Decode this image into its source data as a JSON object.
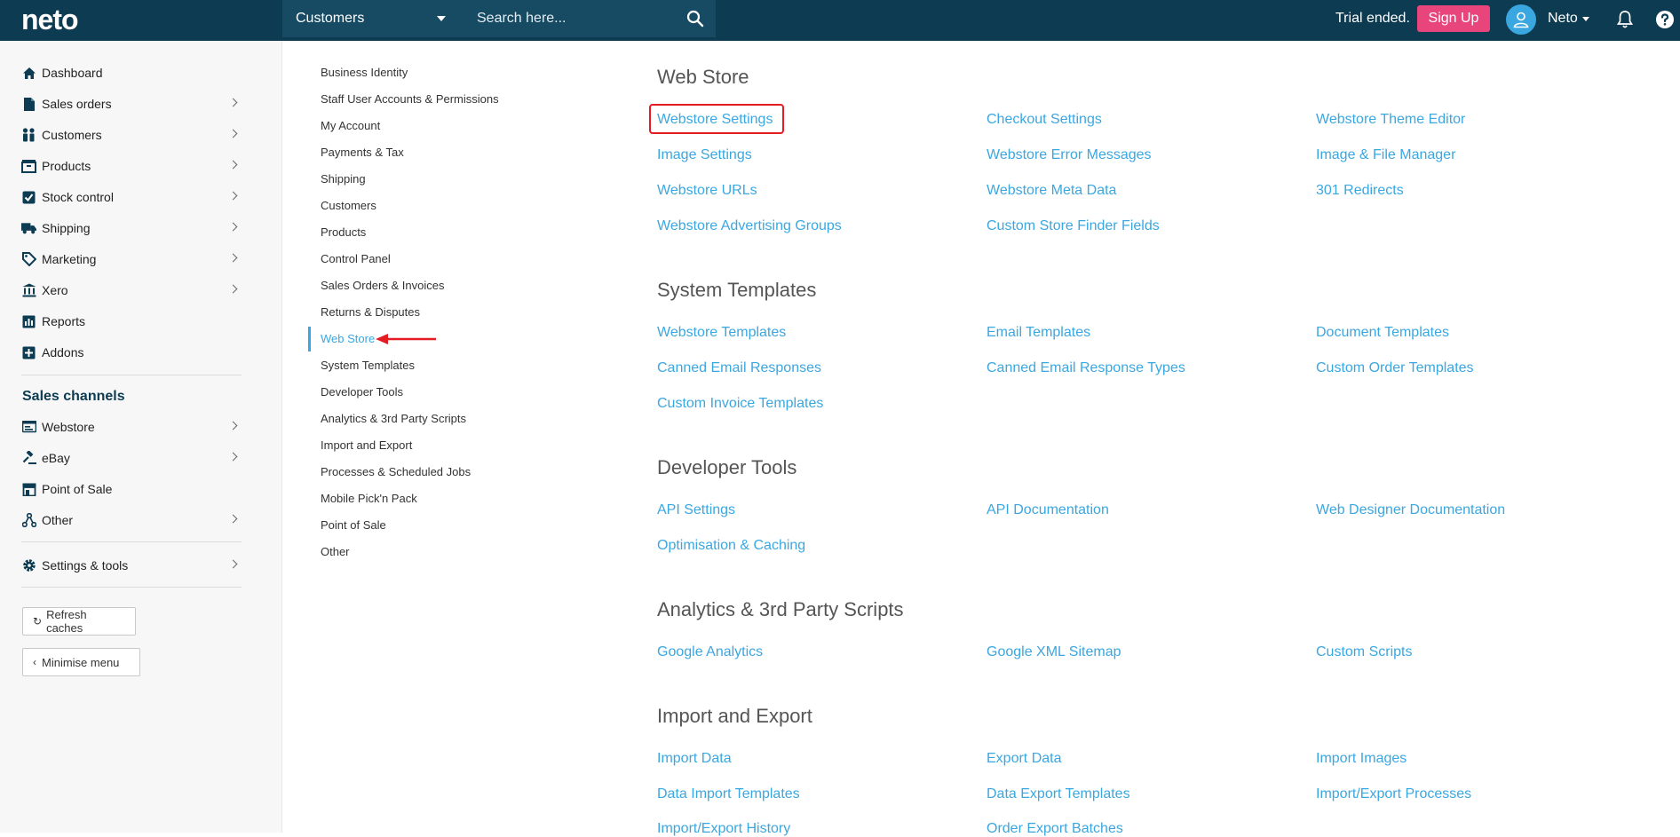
{
  "topbar": {
    "logo": "neto",
    "search_scope": "Customers",
    "search_placeholder": "Search here...",
    "trial_text": "Trial ended.",
    "signup_label": "Sign Up",
    "user_name": "Neto"
  },
  "sidebar": {
    "items": [
      {
        "label": "Dashboard",
        "icon": "home-icon"
      },
      {
        "label": "Sales orders",
        "icon": "document-icon"
      },
      {
        "label": "Customers",
        "icon": "people-icon"
      },
      {
        "label": "Products",
        "icon": "box-icon"
      },
      {
        "label": "Stock control",
        "icon": "checkbox-icon"
      },
      {
        "label": "Shipping",
        "icon": "truck-icon"
      },
      {
        "label": "Marketing",
        "icon": "tag-icon"
      },
      {
        "label": "Xero",
        "icon": "bank-icon"
      },
      {
        "label": "Reports",
        "icon": "chart-icon"
      },
      {
        "label": "Addons",
        "icon": "plus-square-icon"
      }
    ],
    "channels_title": "Sales channels",
    "channels": [
      {
        "label": "Webstore",
        "icon": "monitor-icon"
      },
      {
        "label": "eBay",
        "icon": "gavel-icon"
      },
      {
        "label": "Point of Sale",
        "icon": "store-icon"
      },
      {
        "label": "Other",
        "icon": "share-icon"
      }
    ],
    "settings_label": "Settings & tools",
    "refresh_label": "Refresh caches",
    "minimise_label": "Minimise menu"
  },
  "settings_menu": [
    "Business Identity",
    "Staff User Accounts & Permissions",
    "My Account",
    "Payments & Tax",
    "Shipping",
    "Customers",
    "Products",
    "Control Panel",
    "Sales Orders & Invoices",
    "Returns & Disputes",
    "Web Store",
    "System Templates",
    "Developer Tools",
    "Analytics & 3rd Party Scripts",
    "Import and Export",
    "Processes & Scheduled Jobs",
    "Mobile Pick'n Pack",
    "Point of Sale",
    "Other"
  ],
  "active_menu": "Web Store",
  "sections": [
    {
      "title": "Web Store",
      "links": [
        "Webstore Settings",
        "Checkout Settings",
        "Webstore Theme Editor",
        "Image Settings",
        "Webstore Error Messages",
        "Image & File Manager",
        "Webstore URLs",
        "Webstore Meta Data",
        "301 Redirects",
        "Webstore Advertising Groups",
        "Custom Store Finder Fields"
      ]
    },
    {
      "title": "System Templates",
      "links": [
        "Webstore Templates",
        "Email Templates",
        "Document Templates",
        "Canned Email Responses",
        "Canned Email Response Types",
        "Custom Order Templates",
        "Custom Invoice Templates"
      ]
    },
    {
      "title": "Developer Tools",
      "links": [
        "API Settings",
        "API Documentation",
        "Web Designer Documentation",
        "Optimisation & Caching"
      ]
    },
    {
      "title": "Analytics & 3rd Party Scripts",
      "links": [
        "Google Analytics",
        "Google XML Sitemap",
        "Custom Scripts"
      ]
    },
    {
      "title": "Import and Export",
      "links": [
        "Import Data",
        "Export Data",
        "Import Images",
        "Data Import Templates",
        "Data Export Templates",
        "Import/Export Processes",
        "Import/Export History",
        "Order Export Batches"
      ]
    }
  ],
  "colors": {
    "topbar": "#0d3b52",
    "accent": "#3ba7e0",
    "signup": "#e8457c",
    "highlight": "#e31b23"
  }
}
